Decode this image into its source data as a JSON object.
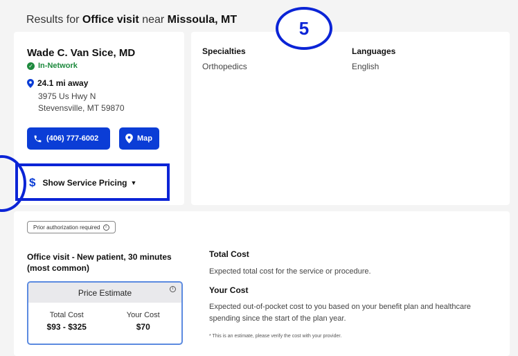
{
  "results": {
    "prefix": "Results for",
    "service": "Office visit",
    "near": "near",
    "location": "Missoula, MT"
  },
  "step_badge": "5",
  "provider": {
    "name": "Wade C. Van Sice, MD",
    "network": "In-Network",
    "distance": "24.1 mi away",
    "address_line1": "3975 Us Hwy N",
    "address_line2": "Stevensville, MT 59870",
    "phone_label": "(406) 777-6002",
    "map_label": "Map",
    "pricing_toggle_label": "Show Service Pricing"
  },
  "details": {
    "specialties_heading": "Specialties",
    "specialties_value": "Orthopedics",
    "languages_heading": "Languages",
    "languages_value": "English"
  },
  "pricing": {
    "auth_badge": "Prior authorization required",
    "service_title": "Office visit - New patient, 30 minutes (most common)",
    "estimate_header": "Price Estimate",
    "total_cost_label": "Total Cost",
    "total_cost_value": "$93 - $325",
    "your_cost_label": "Your Cost",
    "your_cost_value": "$70",
    "total_cost_heading": "Total Cost",
    "total_cost_desc": "Expected total cost for the service or procedure.",
    "your_cost_heading": "Your Cost",
    "your_cost_desc": "Expected out-of-pocket cost to you based on your benefit plan and healthcare spending since the start of the plan year.",
    "disclaimer": "* This is an estimate, please verify the cost with your provider."
  },
  "colors": {
    "accent": "#0b3dd6",
    "highlight": "#0b24d6",
    "in_network": "#1e8a3e"
  }
}
